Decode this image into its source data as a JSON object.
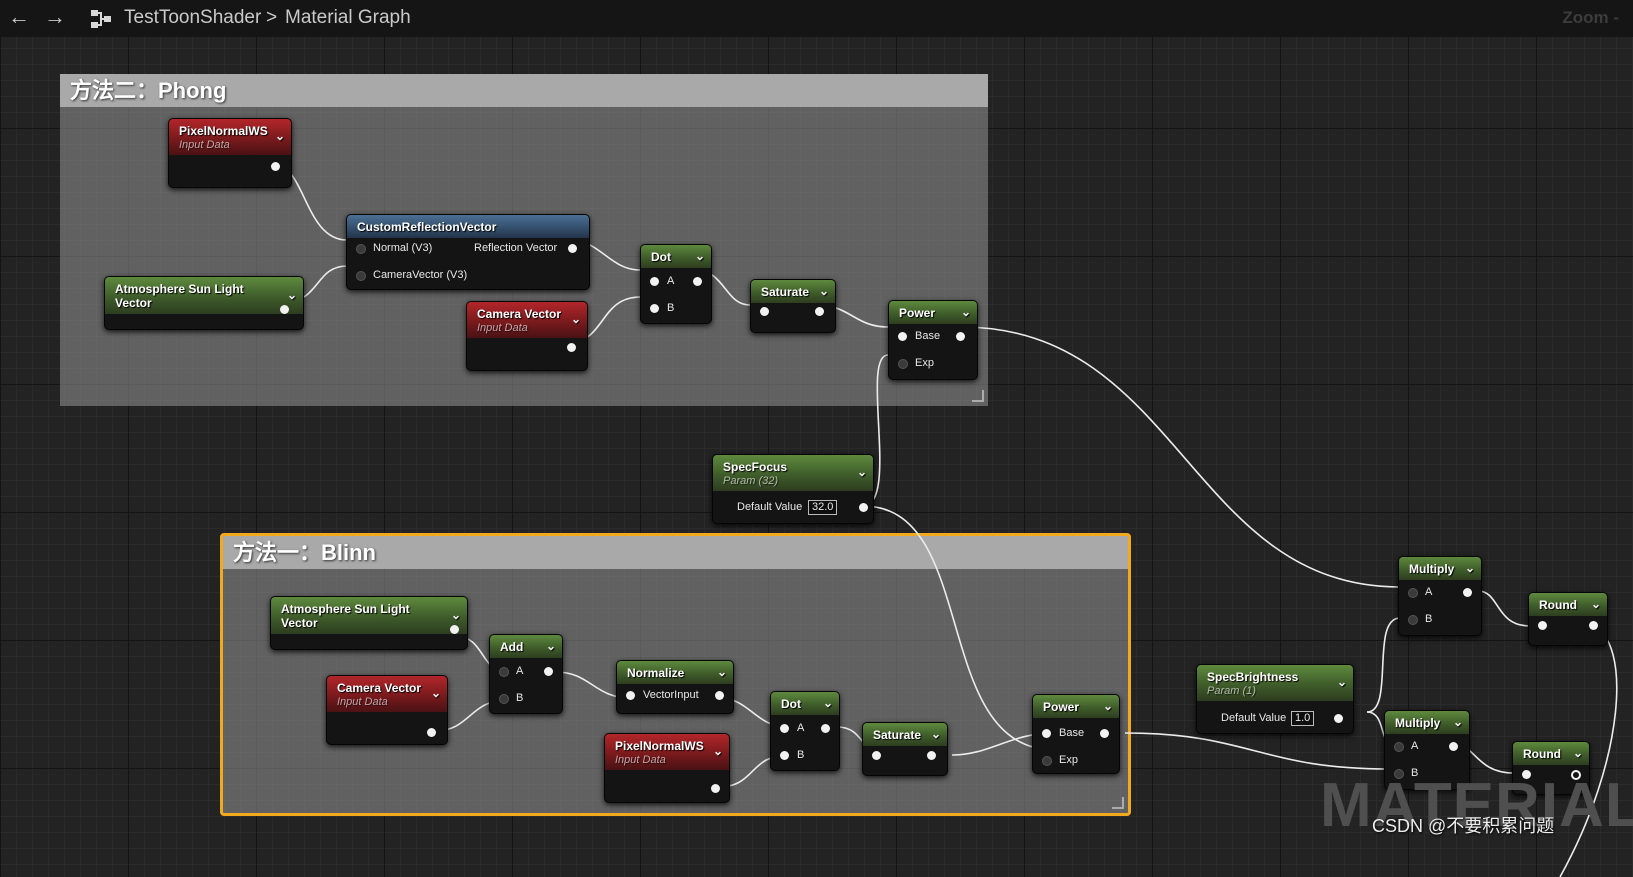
{
  "topbar": {
    "back_icon": "left-arrow-icon",
    "forward_icon": "right-arrow-icon",
    "graph_icon": "graph-icon",
    "crumb_asset": "TestToonShader",
    "crumb_sep": ">",
    "crumb_graph": "Material Graph",
    "zoom_label": "Zoom -"
  },
  "comments": {
    "phong": {
      "title": "方法二：Phong"
    },
    "blinn": {
      "title": "方法一：Blinn"
    }
  },
  "nodes": {
    "phong_pixelnormal": {
      "title": "PixelNormalWS",
      "subtitle": "Input Data"
    },
    "phong_reflect": {
      "title": "CustomReflectionVector",
      "in_normal": "Normal (V3)",
      "in_camera": "CameraVector (V3)",
      "out_reflection": "Reflection Vector"
    },
    "phong_sunlight": {
      "title": "Atmosphere Sun Light Vector"
    },
    "phong_camera": {
      "title": "Camera Vector",
      "subtitle": "Input Data"
    },
    "phong_dot": {
      "title": "Dot",
      "in_a": "A",
      "in_b": "B"
    },
    "phong_saturate": {
      "title": "Saturate"
    },
    "phong_power": {
      "title": "Power",
      "in_base": "Base",
      "in_exp": "Exp"
    },
    "specfocus": {
      "title": "SpecFocus",
      "subtitle": "Param (32)",
      "default_label": "Default Value",
      "default_value": "32.0"
    },
    "blinn_sunlight": {
      "title": "Atmosphere Sun Light Vector"
    },
    "blinn_add": {
      "title": "Add",
      "in_a": "A",
      "in_b": "B"
    },
    "blinn_camera": {
      "title": "Camera Vector",
      "subtitle": "Input Data"
    },
    "blinn_normalize": {
      "title": "Normalize",
      "in_vector": "VectorInput"
    },
    "blinn_pixelnormal": {
      "title": "PixelNormalWS",
      "subtitle": "Input Data"
    },
    "blinn_dot": {
      "title": "Dot",
      "in_a": "A",
      "in_b": "B"
    },
    "blinn_saturate": {
      "title": "Saturate"
    },
    "blinn_power": {
      "title": "Power",
      "in_base": "Base",
      "in_exp": "Exp"
    },
    "specbrightness": {
      "title": "SpecBrightness",
      "subtitle": "Param (1)",
      "default_label": "Default Value",
      "default_value": "1.0"
    },
    "multiply_top": {
      "title": "Multiply",
      "in_a": "A",
      "in_b": "B"
    },
    "round_top": {
      "title": "Round"
    },
    "multiply_bottom": {
      "title": "Multiply",
      "in_a": "A",
      "in_b": "B"
    },
    "round_bottom": {
      "title": "Round"
    }
  },
  "watermark": {
    "material": "MATERIAL",
    "csdn": "CSDN @不要积累问题"
  },
  "colors": {
    "selection": "#f2a91e",
    "green_header": "#4a6b32",
    "red_header": "#8b1e21",
    "blue_header": "#3d5b7c",
    "wire": "#ececec"
  }
}
